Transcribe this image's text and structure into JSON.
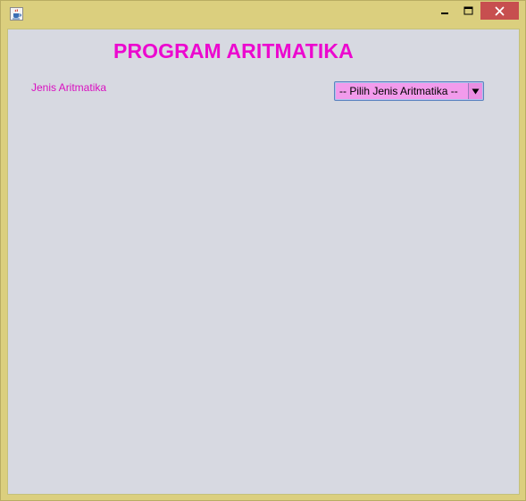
{
  "window": {
    "icon": "java-coffee-cup-icon",
    "controls": {
      "minimize_icon": "minimize-icon",
      "maximize_icon": "maximize-icon",
      "close_icon": "close-icon"
    },
    "frame_color": "#dbcf7e",
    "close_color": "#c74f4f"
  },
  "main": {
    "title": "PROGRAM ARITMATIKA",
    "title_color": "#ec08cf",
    "background": "#d7d9e1",
    "jenis_label": "Jenis Aritmatika",
    "jenis_select": {
      "selected": "-- Pilih Jenis Aritmatika --",
      "arrow_icon": "dropdown-arrow-icon",
      "background": "#f29bec"
    }
  }
}
